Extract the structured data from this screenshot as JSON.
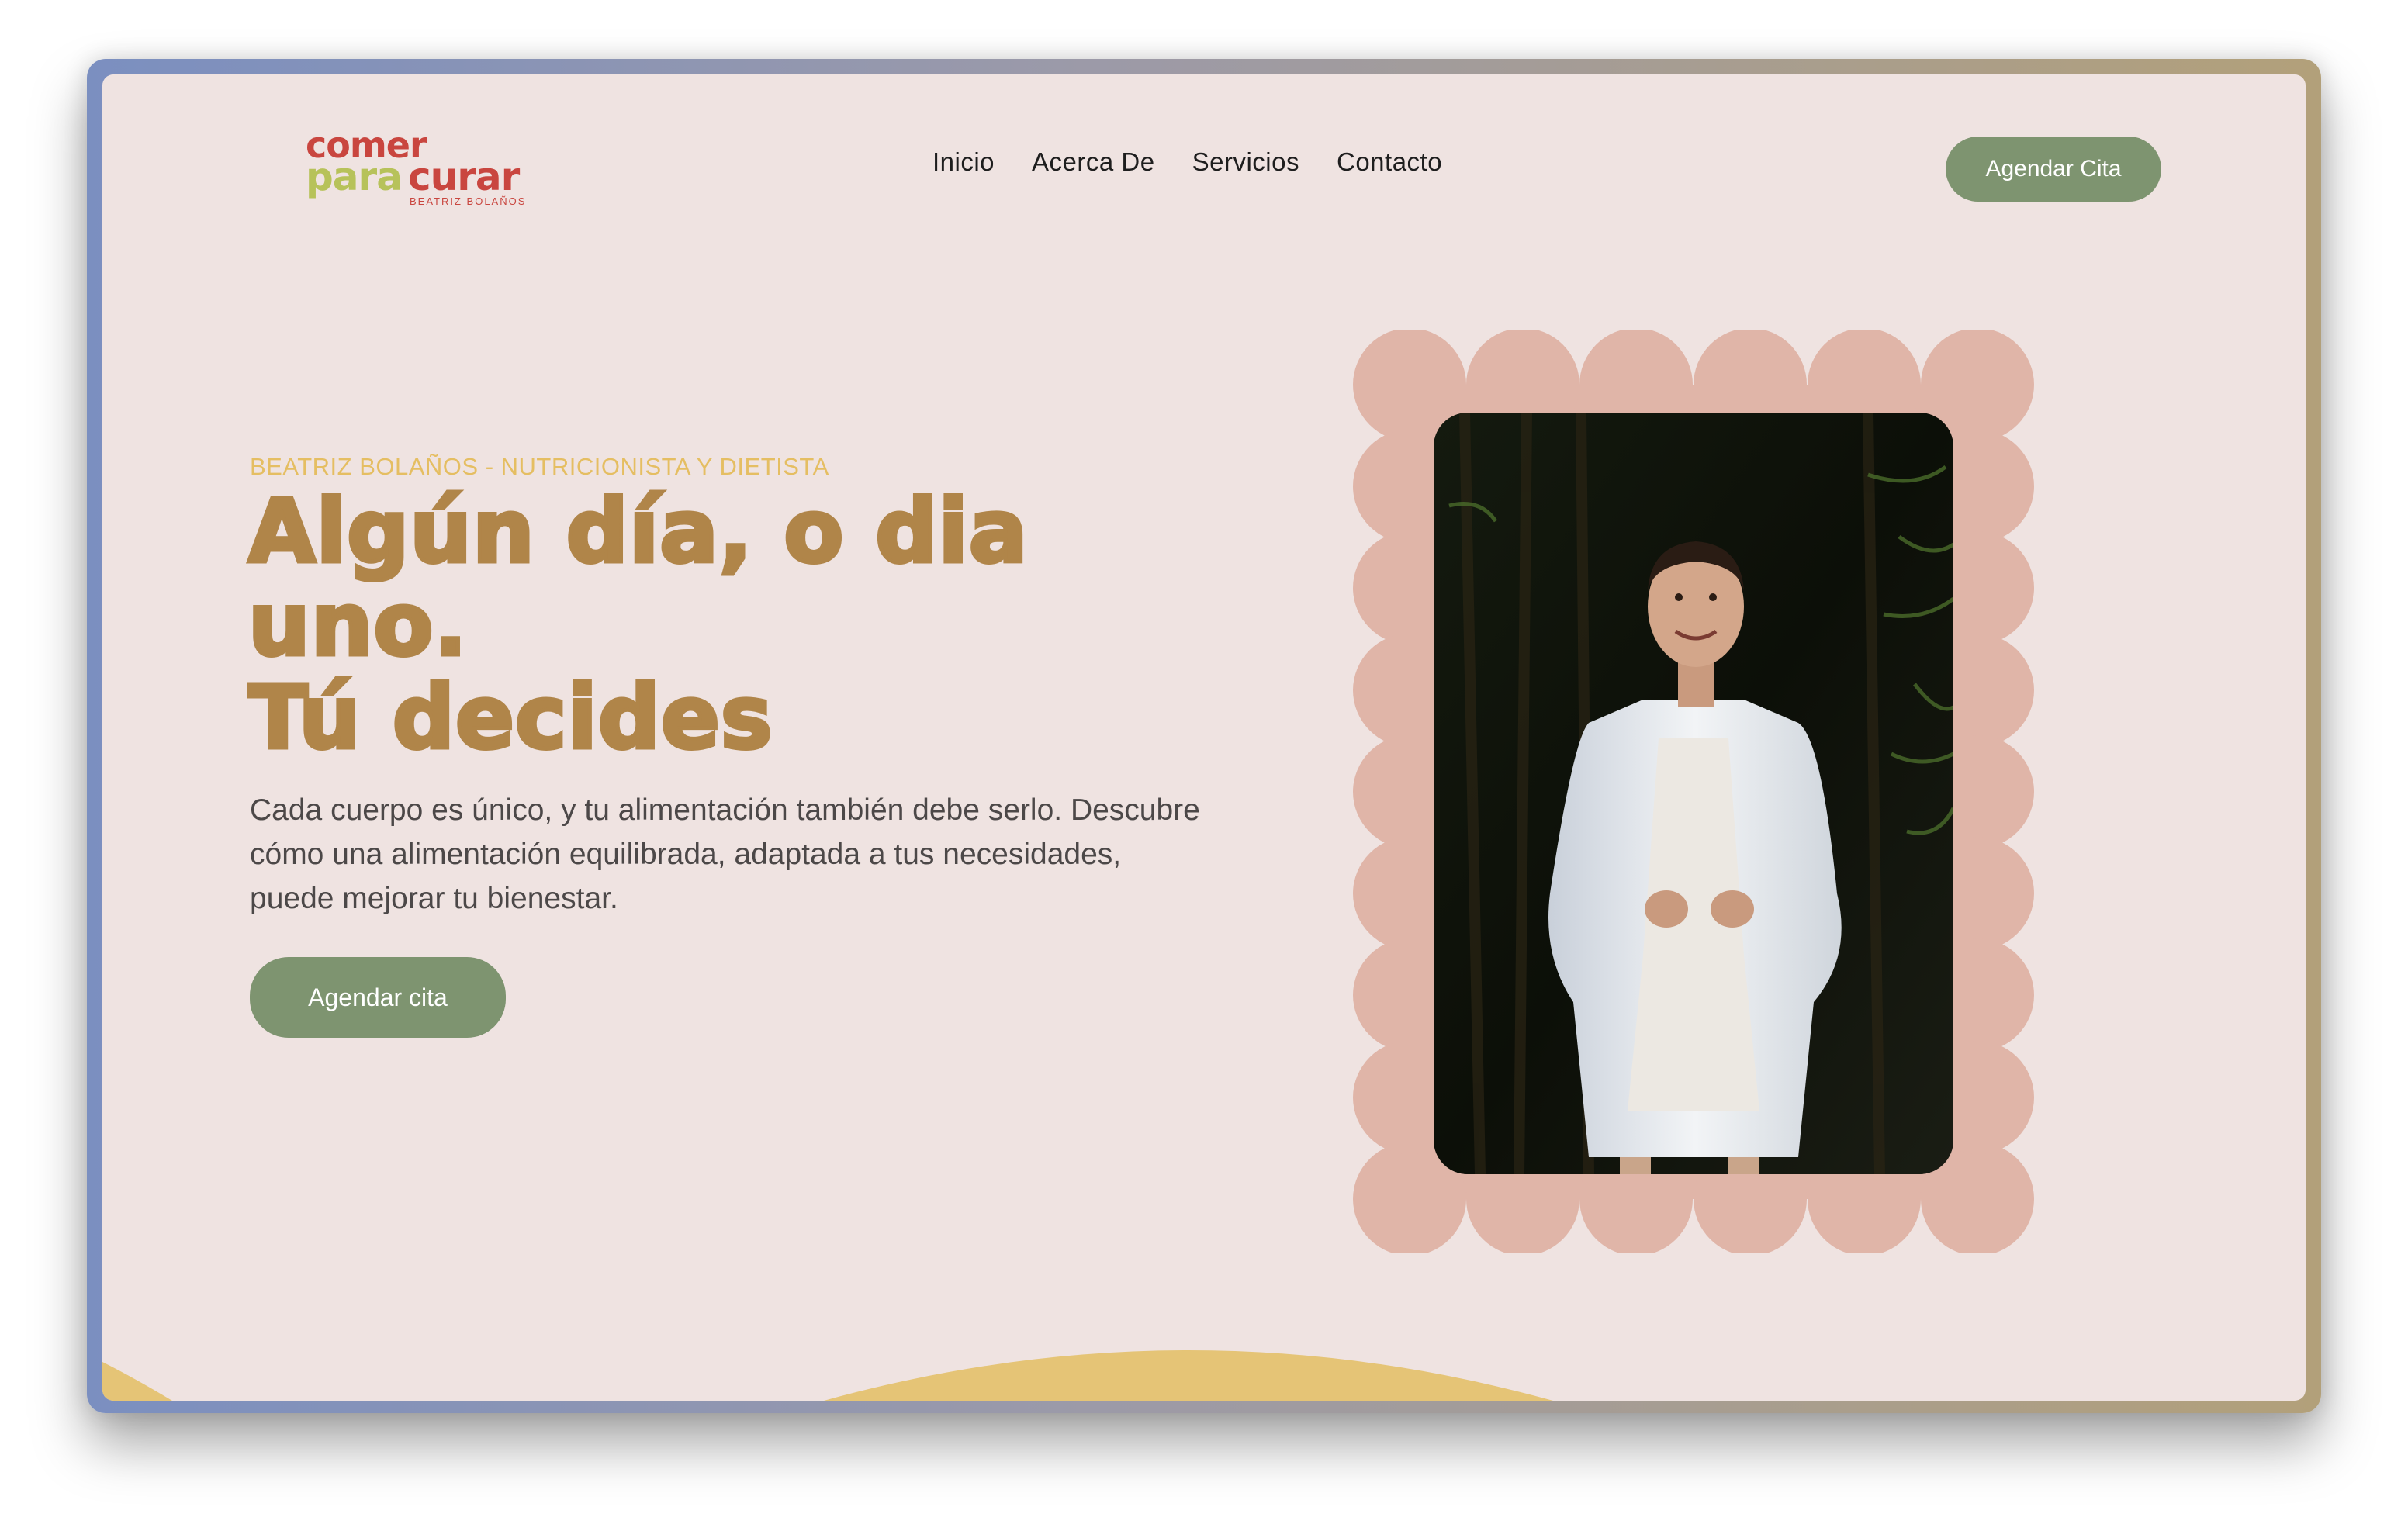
{
  "logo": {
    "line1": "comer",
    "line2a": "para",
    "line2b": "curar",
    "subtitle": "BEATRIZ BOLAÑOS"
  },
  "nav": {
    "items": [
      "Inicio",
      "Acerca De",
      "Servicios",
      "Contacto"
    ]
  },
  "header": {
    "cta_label": "Agendar Cita"
  },
  "hero": {
    "eyebrow": "BEATRIZ BOLAÑOS - NUTRICIONISTA Y DIETISTA",
    "headline_line1": "Algún día, o dia",
    "headline_line2": "uno.",
    "headline_line3": "Tú decides",
    "description": "Cada cuerpo es único, y tu alimentación también debe serlo. Descubre cómo una alimentación equilibrada, adaptada a tus necesidades, puede mejorar tu bienestar.",
    "cta_label": "Agendar cita"
  },
  "colors": {
    "background": "#efe3e1",
    "accent_green": "#7e9470",
    "headline_brown": "#b08549",
    "eyebrow_gold": "#e5be62",
    "frame_pink": "#e0b5a8",
    "wave_yellow": "#e5c476",
    "logo_red": "#c9463f",
    "logo_green": "#b7c25a"
  }
}
